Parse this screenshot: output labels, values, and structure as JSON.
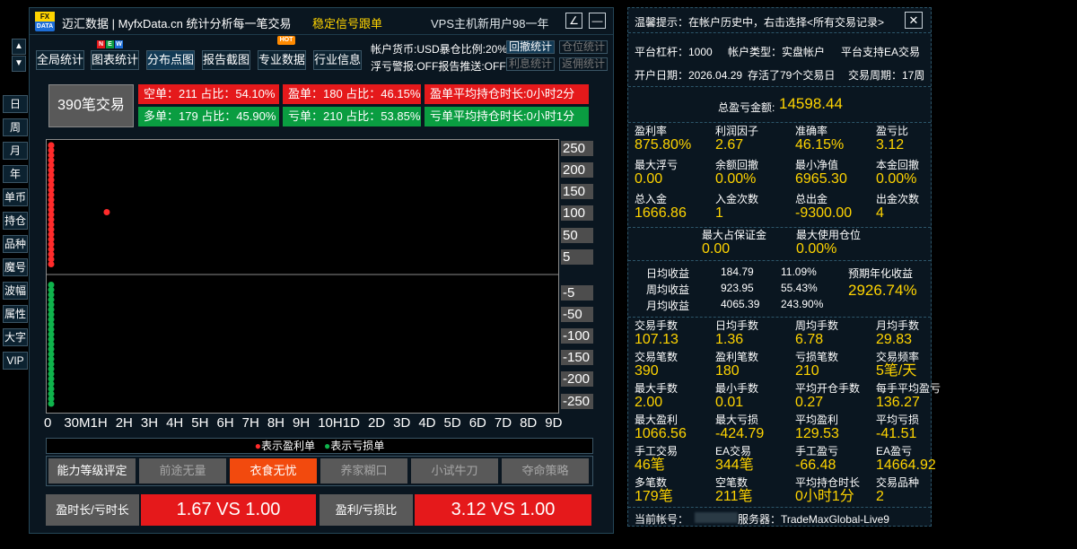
{
  "left_nav": {
    "up": "▲",
    "down": "▼",
    "items": [
      "日",
      "周",
      "月",
      "年",
      "单币",
      "持仓",
      "品种",
      "魔号",
      "波幅",
      "属性",
      "大字",
      "VIP"
    ]
  },
  "titlebar": {
    "logo_top": "FX",
    "logo_bottom": "DATA",
    "title": "迈汇数据 | MyfxData.cn  统计分析每一笔交易",
    "signal": "稳定信号跟单",
    "vps": "VPS主机新用户98一年",
    "edit_icon": "∠",
    "min_icon": "—"
  },
  "toolbar": {
    "buttons": [
      "全局统计",
      "图表统计",
      "分布点图",
      "报告截图",
      "专业数据",
      "行业信息"
    ],
    "new_badge": [
      "N",
      "E",
      "W"
    ],
    "hot_badge": "HOT",
    "account_line1": "帐户货币:USD暴仓比例:20%",
    "account_line2": "浮亏警报:OFF报告推送:OFF",
    "btn_review": "回撤统计",
    "btn_position": "仓位统计",
    "btn_interest": "利息统计",
    "btn_rebate": "返佣统计"
  },
  "summary": {
    "total_trades": "390笔交易",
    "short": "空单：211  占比：54.10%",
    "win": "盈单：180  占比：46.15%",
    "win_hold": "盈单平均持仓时长:0小时2分",
    "long": "多单：179  占比：45.90%",
    "loss": "亏单：210  占比：53.85%",
    "loss_hold": "亏单平均持仓时长:0小时1分"
  },
  "chart_data": {
    "type": "scatter",
    "title": "",
    "xlabel": "",
    "ylabel": "",
    "x_ticks": [
      "0",
      "30M",
      "1H",
      "2H",
      "3H",
      "4H",
      "5H",
      "6H",
      "7H",
      "8H",
      "9H",
      "10H",
      "1D",
      "2D",
      "3D",
      "4D",
      "5D",
      "6D",
      "7D",
      "8D",
      "9D"
    ],
    "y_ticks": [
      250,
      200,
      150,
      100,
      50,
      5,
      -5,
      -50,
      -100,
      -150,
      -200,
      -250
    ],
    "legend": [
      "表示盈利单",
      "表示亏损单"
    ],
    "colors": {
      "profit": "#ff2b2b",
      "loss": "#0fb34c"
    },
    "series": [
      {
        "name": "表示盈利单",
        "points": [
          [
            0,
            1066.56
          ],
          [
            0,
            250
          ],
          [
            0,
            240
          ],
          [
            0,
            230
          ],
          [
            0,
            220
          ],
          [
            0,
            210
          ],
          [
            0,
            200
          ],
          [
            0,
            190
          ],
          [
            0,
            180
          ],
          [
            0,
            170
          ],
          [
            0,
            160
          ],
          [
            0,
            150
          ],
          [
            0,
            140
          ],
          [
            0,
            130
          ],
          [
            0,
            120
          ],
          [
            0,
            110
          ],
          [
            0,
            100
          ],
          [
            0,
            90
          ],
          [
            0,
            80
          ],
          [
            0,
            70
          ],
          [
            0,
            60
          ],
          [
            0,
            50
          ],
          [
            0,
            40
          ],
          [
            0,
            30
          ],
          [
            0,
            20
          ],
          [
            0,
            10
          ],
          [
            2.1,
            115
          ]
        ]
      },
      {
        "name": "表示亏损单",
        "points": [
          [
            0,
            -10
          ],
          [
            0,
            -20
          ],
          [
            0,
            -30
          ],
          [
            0,
            -40
          ],
          [
            0,
            -50
          ],
          [
            0,
            -60
          ],
          [
            0,
            -70
          ],
          [
            0,
            -80
          ],
          [
            0,
            -90
          ],
          [
            0,
            -100
          ],
          [
            0,
            -110
          ],
          [
            0,
            -120
          ],
          [
            0,
            -130
          ],
          [
            0,
            -140
          ],
          [
            0,
            -150
          ],
          [
            0,
            -160
          ],
          [
            0,
            -170
          ],
          [
            0,
            -180
          ],
          [
            0,
            -190
          ],
          [
            0,
            -200
          ],
          [
            0,
            -210
          ],
          [
            0,
            -220
          ],
          [
            0,
            -230
          ],
          [
            0,
            -240
          ],
          [
            0,
            -250
          ]
        ]
      }
    ]
  },
  "levels": {
    "label": "能力等级评定",
    "items": [
      "前途无量",
      "衣食无忧",
      "养家糊口",
      "小试牛刀",
      "夺命策略"
    ],
    "active_index": 1
  },
  "compare": {
    "time_label": "盈时长/亏时长",
    "time_value": "1.67 VS 1.00",
    "pnl_label": "盈利/亏损比",
    "pnl_value": "3.12 VS 1.00"
  },
  "right": {
    "tip": "温馨提示：在帐户历史中，右击选择<所有交易记录>",
    "close_icon": "✕",
    "leverage": "平台杠杆：1000",
    "acct_type": "帐户类型：实盘帐户",
    "ea": "平台支持EA交易",
    "open_date": "开户日期：2026.04.29",
    "stored": "存活了79个交易日",
    "period": "交易周期：17周",
    "total_pnl_label": "总盈亏金额:",
    "total_pnl": "14598.44",
    "grid1": [
      {
        "label": "盈利率",
        "value": "875.80%"
      },
      {
        "label": "利润因子",
        "value": "2.67"
      },
      {
        "label": "准确率",
        "value": "46.15%"
      },
      {
        "label": "盈亏比",
        "value": "3.12"
      },
      {
        "label": "最大浮亏",
        "value": "0.00"
      },
      {
        "label": "余额回撤",
        "value": "0.00%"
      },
      {
        "label": "最小净值",
        "value": "6965.30"
      },
      {
        "label": "本金回撤",
        "value": "0.00%"
      },
      {
        "label": "总入金",
        "value": "1666.86"
      },
      {
        "label": "入金次数",
        "value": "1"
      },
      {
        "label": "总出金",
        "value": "-9300.00"
      },
      {
        "label": "出金次数",
        "value": "4"
      }
    ],
    "margin": [
      {
        "label": "最大占保证金",
        "value": "0.00"
      },
      {
        "label": "最大使用仓位",
        "value": "0.00%"
      }
    ],
    "income": {
      "rows": [
        {
          "label": "日均收益",
          "value": "184.79",
          "pct": "11.09%"
        },
        {
          "label": "周均收益",
          "value": "923.95",
          "pct": "55.43%"
        },
        {
          "label": "月均收益",
          "value": "4065.39",
          "pct": "243.90%"
        }
      ],
      "annual_label": "预期年化收益",
      "annual_value": "2926.74%"
    },
    "grid2": [
      {
        "label": "交易手数",
        "value": "107.13"
      },
      {
        "label": "日均手数",
        "value": "1.36"
      },
      {
        "label": "周均手数",
        "value": "6.78"
      },
      {
        "label": "月均手数",
        "value": "29.83"
      },
      {
        "label": "交易笔数",
        "value": "390"
      },
      {
        "label": "盈利笔数",
        "value": "180"
      },
      {
        "label": "亏损笔数",
        "value": "210"
      },
      {
        "label": "交易频率",
        "value": "5笔/天"
      },
      {
        "label": "最大手数",
        "value": "2.00"
      },
      {
        "label": "最小手数",
        "value": "0.01"
      },
      {
        "label": "平均开仓手数",
        "value": "0.27"
      },
      {
        "label": "每手平均盈亏",
        "value": "136.27"
      },
      {
        "label": "最大盈利",
        "value": "1066.56"
      },
      {
        "label": "最大亏损",
        "value": "-424.79"
      },
      {
        "label": "平均盈利",
        "value": "129.53"
      },
      {
        "label": "平均亏损",
        "value": "-41.51"
      },
      {
        "label": "手工交易",
        "value": "46笔"
      },
      {
        "label": "EA交易",
        "value": "344笔"
      },
      {
        "label": "手工盈亏",
        "value": "-66.48"
      },
      {
        "label": "EA盈亏",
        "value": "14664.92"
      },
      {
        "label": "多笔数",
        "value": "179笔"
      },
      {
        "label": "空笔数",
        "value": "211笔"
      },
      {
        "label": "平均持仓时长",
        "value": "0小时1分"
      },
      {
        "label": "交易品种",
        "value": "2"
      }
    ],
    "account_label": "当前帐号：",
    "server": "服务器：TradeMaxGlobal-Live9"
  }
}
